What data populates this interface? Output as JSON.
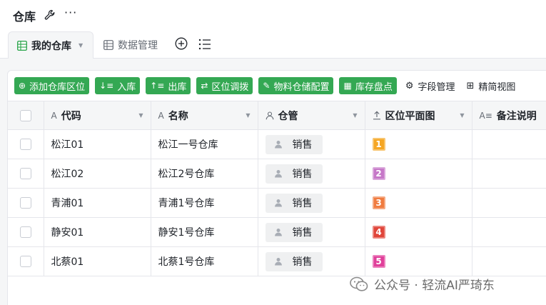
{
  "app": {
    "title": "仓库",
    "more": "···"
  },
  "tabs": [
    {
      "label": "我的仓库",
      "active": true
    },
    {
      "label": "数据管理",
      "active": false
    }
  ],
  "toolbar": {
    "buttons": [
      {
        "icon": "⊕",
        "label": "添加仓库区位"
      },
      {
        "icon": "↓≡",
        "label": "入库"
      },
      {
        "icon": "↑≡",
        "label": "出库"
      },
      {
        "icon": "⇄",
        "label": "区位调拨"
      },
      {
        "icon": "✎",
        "label": "物料仓储配置"
      },
      {
        "icon": "▦",
        "label": "库存盘点"
      }
    ],
    "links": [
      {
        "icon": "⚙",
        "label": "字段管理"
      },
      {
        "icon": "⊞",
        "label": "精简视图"
      }
    ],
    "accent": "#34a853"
  },
  "table": {
    "columns": [
      {
        "icon": "A",
        "label": "代码"
      },
      {
        "icon": "A",
        "label": "名称"
      },
      {
        "icon": "person-icon",
        "label": "仓管"
      },
      {
        "icon": "upload-icon",
        "label": "区位平面图"
      },
      {
        "icon": "A≡",
        "label": "备注说明"
      }
    ],
    "rows": [
      {
        "code": "松江01",
        "name": "松江一号仓库",
        "manager": "销售",
        "image": {
          "num": "1",
          "color": "#f5a623"
        }
      },
      {
        "code": "松江02",
        "name": "松江2号仓库",
        "manager": "销售",
        "image": {
          "num": "2",
          "color": "#c678c8"
        }
      },
      {
        "code": "青浦01",
        "name": "青浦1号仓库",
        "manager": "销售",
        "image": {
          "num": "3",
          "color": "#f07b3f"
        }
      },
      {
        "code": "静安01",
        "name": "静安1号仓库",
        "manager": "销售",
        "image": {
          "num": "4",
          "color": "#e0453a"
        }
      },
      {
        "code": "北蔡01",
        "name": "北蔡1号仓库",
        "manager": "销售",
        "image": {
          "num": "5",
          "color": "#e0409a"
        }
      }
    ]
  },
  "watermark": {
    "text": "公众号 · 轻流AI严琦东"
  }
}
